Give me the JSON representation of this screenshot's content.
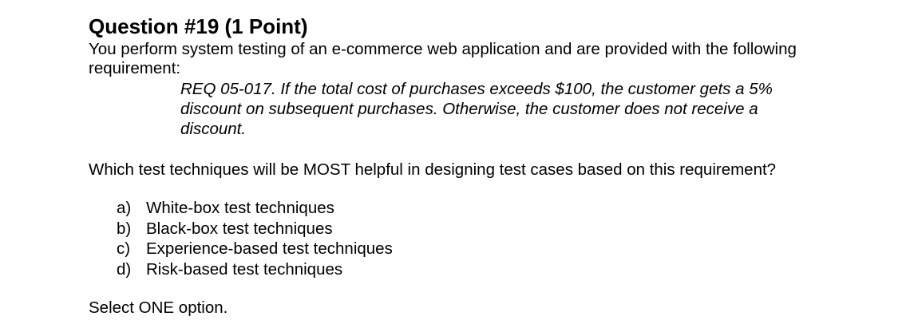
{
  "question": {
    "title": "Question #19 (1 Point)",
    "intro_lines": [
      "You perform system testing of an e-commerce web application and are provided with the following",
      "requirement:"
    ],
    "requirement_lines": [
      "REQ 05-017. If the total cost of purchases exceeds $100, the customer gets a 5%",
      "discount on subsequent purchases. Otherwise, the customer does not receive a",
      "discount."
    ],
    "prompt": "Which test techniques will be MOST helpful in designing test cases based on this requirement?",
    "options": [
      {
        "letter": "a)",
        "text": "White-box test techniques"
      },
      {
        "letter": "b)",
        "text": "Black-box test techniques"
      },
      {
        "letter": "c)",
        "text": "Experience-based test techniques"
      },
      {
        "letter": "d)",
        "text": "Risk-based test techniques"
      }
    ],
    "instruction": "Select ONE option."
  }
}
